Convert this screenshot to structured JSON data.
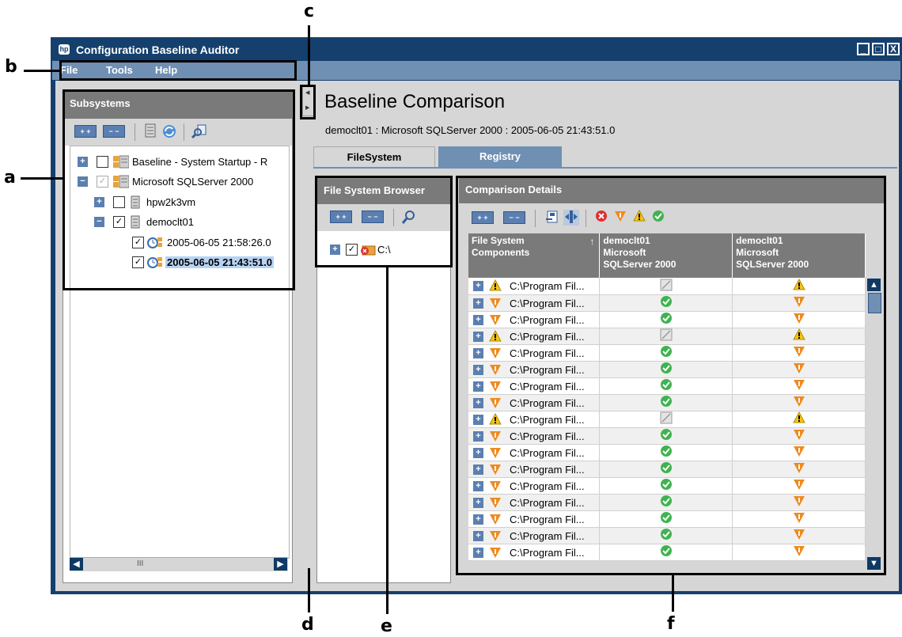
{
  "window": {
    "title": "Configuration Baseline Auditor",
    "logo": "hp",
    "controls": [
      "_",
      "□",
      "X"
    ]
  },
  "menu": {
    "items": [
      "File",
      "Tools",
      "Help"
    ]
  },
  "subsystems": {
    "header": "Subsystems",
    "toolbar": {
      "expand": "+ +",
      "collapse": "− −"
    },
    "tree": [
      {
        "label": "Baseline - System Startup - R",
        "expander": "+",
        "checked": false,
        "icon": "baseline-icon"
      },
      {
        "label": "Microsoft SQLServer 2000",
        "expander": "−",
        "checked": true,
        "dim": true,
        "icon": "baseline-icon"
      },
      {
        "label": "hpw2k3vm",
        "expander": "+",
        "checked": false,
        "icon": "server-icon"
      },
      {
        "label": "democlt01",
        "expander": "−",
        "checked": true,
        "icon": "server-icon"
      },
      {
        "label": "2005-06-05 21:58:26.0",
        "checked": true,
        "icon": "snapshot-icon"
      },
      {
        "label": "2005-06-05 21:43:51.0",
        "checked": true,
        "icon": "snapshot-icon",
        "selected": true
      }
    ],
    "scroll_thumb": "III"
  },
  "main": {
    "title": "Baseline Comparison",
    "subtitle": "democlt01 : Microsoft SQLServer 2000 : 2005-06-05 21:43:51.0",
    "tabs": [
      "FileSystem",
      "Registry"
    ]
  },
  "fs_browser": {
    "header": "File System Browser",
    "toolbar": {
      "expand": "+ +",
      "collapse": "− −"
    },
    "tree": [
      {
        "label": "C:\\",
        "expander": "+",
        "checked": true
      }
    ]
  },
  "comparison": {
    "header": "Comparison Details",
    "toolbar": {
      "expand": "+ +",
      "collapse": "− −"
    },
    "columns": [
      {
        "lines": [
          "File System",
          "Components"
        ],
        "sort": "↑"
      },
      {
        "lines": [
          "democlt01",
          "Microsoft",
          "SQLServer 2000"
        ]
      },
      {
        "lines": [
          "democlt01",
          "Microsoft",
          "SQLServer 2000"
        ]
      }
    ],
    "rows": [
      {
        "path": "C:\\Program Fil...",
        "kind": "warn",
        "a": "na",
        "b": "warn"
      },
      {
        "path": "C:\\Program Fil...",
        "kind": "diff",
        "a": "ok",
        "b": "diff"
      },
      {
        "path": "C:\\Program Fil...",
        "kind": "diff",
        "a": "ok",
        "b": "diff"
      },
      {
        "path": "C:\\Program Fil...",
        "kind": "warn",
        "a": "na",
        "b": "warn"
      },
      {
        "path": "C:\\Program Fil...",
        "kind": "diff",
        "a": "ok",
        "b": "diff"
      },
      {
        "path": "C:\\Program Fil...",
        "kind": "diff",
        "a": "ok",
        "b": "diff"
      },
      {
        "path": "C:\\Program Fil...",
        "kind": "diff",
        "a": "ok",
        "b": "diff"
      },
      {
        "path": "C:\\Program Fil...",
        "kind": "diff",
        "a": "ok",
        "b": "diff"
      },
      {
        "path": "C:\\Program Fil...",
        "kind": "warn",
        "a": "na",
        "b": "warn"
      },
      {
        "path": "C:\\Program Fil...",
        "kind": "diff",
        "a": "ok",
        "b": "diff"
      },
      {
        "path": "C:\\Program Fil...",
        "kind": "diff",
        "a": "ok",
        "b": "diff"
      },
      {
        "path": "C:\\Program Fil...",
        "kind": "diff",
        "a": "ok",
        "b": "diff"
      },
      {
        "path": "C:\\Program Fil...",
        "kind": "diff",
        "a": "ok",
        "b": "diff"
      },
      {
        "path": "C:\\Program Fil...",
        "kind": "diff",
        "a": "ok",
        "b": "diff"
      },
      {
        "path": "C:\\Program Fil...",
        "kind": "diff",
        "a": "ok",
        "b": "diff"
      },
      {
        "path": "C:\\Program Fil...",
        "kind": "diff",
        "a": "ok",
        "b": "diff"
      },
      {
        "path": "C:\\Program Fil...",
        "kind": "diff",
        "a": "ok",
        "b": "diff"
      }
    ]
  },
  "callouts": {
    "a": "a",
    "b": "b",
    "c": "c",
    "d": "d",
    "e": "e",
    "f": "f"
  },
  "colors": {
    "frame": "#15406e",
    "menubar": "#6f8fb3",
    "header": "#7a7a7a",
    "selection": "#b7d3f2",
    "ok": "#3fb34f",
    "error": "#e03030",
    "diff": "#f08a1e",
    "warn": "#f5c518"
  }
}
